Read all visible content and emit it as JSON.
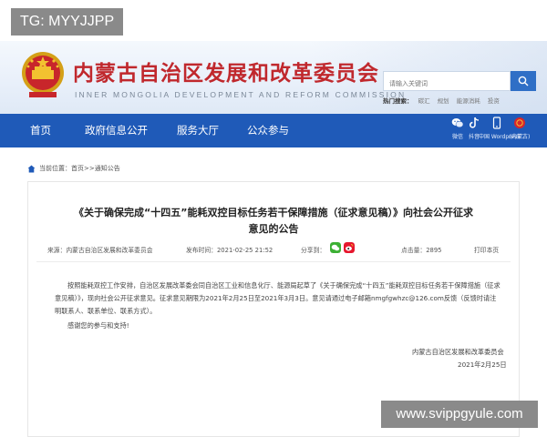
{
  "watermark_top": "TG: MYYJJPP",
  "watermark_bottom": "www.svippgyule.com",
  "header": {
    "site_title": "内蒙古自治区发展和改革委员会",
    "site_title_en": "INNER MONGOLIA DEVELOPMENT AND REFORM COMMISSION",
    "search_placeholder": "请输入关键词",
    "hot_label": "热门搜索：",
    "hot_words": [
      "碳汇",
      "规划",
      "能源消耗",
      "投资"
    ]
  },
  "nav": {
    "items": [
      "首页",
      "政府信息公开",
      "服务大厅",
      "公众参与"
    ],
    "social": [
      {
        "label": "微信",
        "icon": "wechat-icon"
      },
      {
        "label": "抖音",
        "icon": "douyin-icon"
      },
      {
        "label": "中国 Wordpress 二",
        "icon": "mobile-icon"
      },
      {
        "label": "(内蒙古)",
        "icon": "party-emblem-icon"
      }
    ]
  },
  "breadcrumb": {
    "prefix": "当前位置：",
    "home": "首页",
    "sep": ">>",
    "current": "通知公告"
  },
  "article": {
    "title_line1": "《关于确保完成“十四五”能耗双控目标任务若干保障措施（征求意见稿）》向社会公开征求",
    "title_line2": "意见的公告",
    "source_label": "来源：",
    "source": "内蒙古自治区发展和改革委员会",
    "time_label": "发布时间：",
    "time": "2021-02-25 21:52",
    "share_label": "分享到：",
    "views_label": "点击量：",
    "views": "2895",
    "print_label": "打印本页",
    "paragraph1": "按照能耗双控工作安排，自治区发展改革委会同自治区工业和信息化厅、能源局起草了《关于确保完成“十四五”能耗双控目标任务若干保障措施（征求意见稿）》，现向社会公开征求意见。征求意见期限为2021年2月25日至2021年3月3日。意见请通过电子邮箱nmgfgwhzc@126.com反馈（反馈时请注明联系人、联系单位、联系方式）。",
    "paragraph2": "感谢您的参与和支持!",
    "signature_org": "内蒙古自治区发展和改革委员会",
    "signature_date": "2021年2月25日"
  },
  "colors": {
    "nav_bg": "#1f5ab8",
    "title_red": "#c0282d",
    "search_btn": "#2f6fc6"
  }
}
